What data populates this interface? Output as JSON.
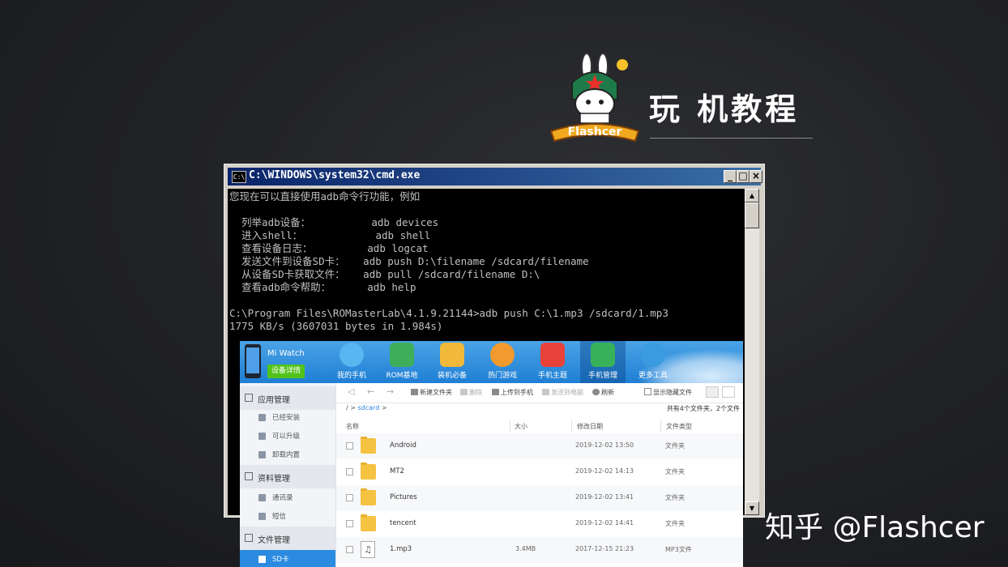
{
  "banner": {
    "title": "玩 机教程",
    "logo_text": "Flashcer",
    "watermark": "知乎 @Flashcer"
  },
  "cmd": {
    "title": "C:\\WINDOWS\\system32\\cmd.exe",
    "buttons": [
      "_",
      "□",
      "×"
    ],
    "lines": [
      "您现在可以直接使用adb命令行功能，例如",
      "",
      "  列举adb设备：          adb devices",
      "  进入shell：            adb shell",
      "  查看设备日志：         adb logcat",
      "  发送文件到设备SD卡：   adb push D:\\filename /sdcard/filename",
      "  从设备SD卡获取文件：   adb pull /sdcard/filename D:\\",
      "  查看adb命令帮助：      adb help",
      "",
      "C:\\Program Files\\ROMasterLab\\4.1.9.21144>adb push C:\\1.mp3 /sdcard/1.mp3",
      "1775 KB/s (3607031 bytes in 1.984s)"
    ]
  },
  "phone_manager": {
    "device_name": "Mi Watch",
    "device_button": "设备详情",
    "tabs": [
      {
        "label": "我的手机",
        "color": "#58b6f0"
      },
      {
        "label": "ROM基地",
        "color": "#3fae5a"
      },
      {
        "label": "装机必备",
        "color": "#f0b93a"
      },
      {
        "label": "热门游戏",
        "color": "#f29a2e"
      },
      {
        "label": "手机主题",
        "color": "#e8423a"
      },
      {
        "label": "手机管理",
        "color": "#38b25a"
      },
      {
        "label": "更多工具",
        "color": "#3a9be0"
      }
    ],
    "sidebar": {
      "sections": [
        {
          "label": "应用管理",
          "items": [
            "已经安装",
            "可以升级",
            "卸载内置"
          ]
        },
        {
          "label": "资料管理",
          "items": [
            "通讯录",
            "短信"
          ]
        },
        {
          "label": "文件管理",
          "items": [
            "SD卡"
          ]
        }
      ]
    },
    "toolbar": {
      "new_folder": "新建文件夹",
      "delete": "删除",
      "upload": "上传到手机",
      "send_pc": "发送到电脑",
      "refresh": "刷新",
      "show_hidden": "显示隐藏文件"
    },
    "breadcrumb": {
      "root": "/",
      "sep1": ">",
      "folder": "sdcard",
      "sep2": ">"
    },
    "count": "共有4个文件夹，2个文件",
    "columns": {
      "name": "名称",
      "size": "大小",
      "date": "修改日期",
      "type": "文件类型"
    },
    "rows": [
      {
        "name": "Android",
        "size": "",
        "date": "2019-12-02 13:50",
        "type": "文件夹"
      },
      {
        "name": "MT2",
        "size": "",
        "date": "2019-12-02 14:13",
        "type": "文件夹"
      },
      {
        "name": "Pictures",
        "size": "",
        "date": "2019-12-02 13:41",
        "type": "文件夹"
      },
      {
        "name": "tencent",
        "size": "",
        "date": "2019-12-02 14:41",
        "type": "文件夹"
      },
      {
        "name": "1.mp3",
        "size": "3.4MB",
        "date": "2017-12-15 21:23",
        "type": "MP3文件"
      }
    ]
  }
}
